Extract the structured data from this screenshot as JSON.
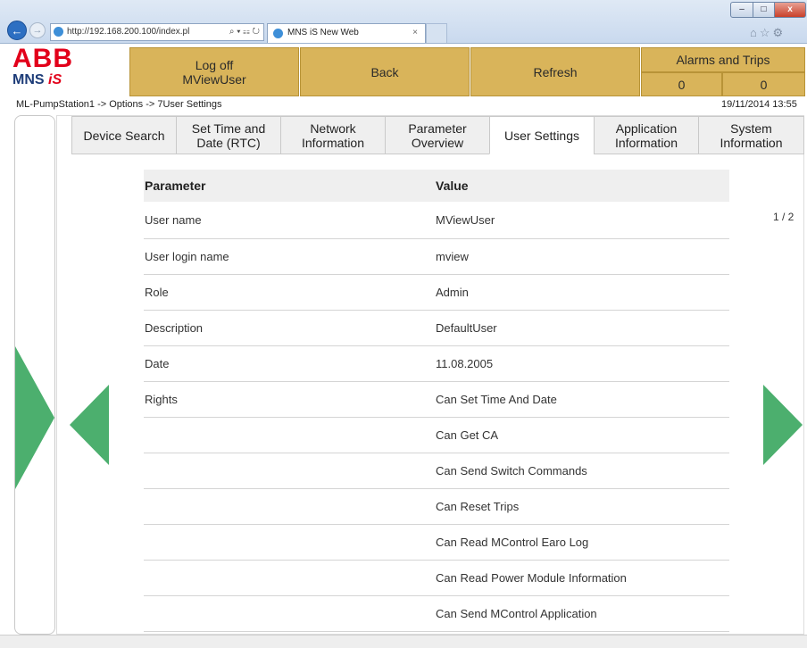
{
  "browser": {
    "url": "http://192.168.200.100/index.pl",
    "address_tools": "⌕ ▾ ☷ ↻",
    "tab_title": "MNS iS New Web",
    "tab_close": "×",
    "back_icon": "←",
    "forward_icon": "→",
    "win_min": "–",
    "win_max": "□",
    "win_close": "x",
    "right_icons": "⌂☆⚙"
  },
  "logo": {
    "brand": "ABB",
    "product_main": "MNS ",
    "product_accent": "iS"
  },
  "header": {
    "logoff_line1": "Log off",
    "logoff_line2": "MViewUser",
    "back": "Back",
    "refresh": "Refresh",
    "alarms_title": "Alarms and Trips",
    "alarm_count_1": "0",
    "alarm_count_2": "0"
  },
  "breadcrumb": "ML-PumpStation1 -> Options -> 7User Settings",
  "datetime": "19/11/2014 13:55",
  "tabs": {
    "device_search": "Device Search",
    "set_time_1": "Set Time and",
    "set_time_2": "Date (RTC)",
    "network_1": "Network",
    "network_2": "Information",
    "param_1": "Parameter",
    "param_2": "Overview",
    "user_settings": "User Settings",
    "app_1": "Application",
    "app_2": "Information",
    "sys_1": "System",
    "sys_2": "Information"
  },
  "table": {
    "col_param": "Parameter",
    "col_value": "Value",
    "rows": [
      {
        "param": "User name",
        "value": "MViewUser"
      },
      {
        "param": "User login name",
        "value": "mview"
      },
      {
        "param": "Role",
        "value": "Admin"
      },
      {
        "param": "Description",
        "value": "DefaultUser"
      },
      {
        "param": "Date",
        "value": "11.08.2005"
      },
      {
        "param": "Rights",
        "value": "Can Set Time And Date"
      },
      {
        "param": "",
        "value": "Can Get CA"
      },
      {
        "param": "",
        "value": "Can Send Switch Commands"
      },
      {
        "param": "",
        "value": "Can Reset Trips"
      },
      {
        "param": "",
        "value": "Can Read MControl Earo Log"
      },
      {
        "param": "",
        "value": "Can Read Power Module Information"
      },
      {
        "param": "",
        "value": "Can Send MControl Application"
      }
    ]
  },
  "page_indicator": "1 / 2",
  "colors": {
    "button_gold": "#d9b45a",
    "arrow_green": "#4caf6e",
    "abb_red": "#e2001a",
    "mns_blue": "#1d3c78"
  }
}
